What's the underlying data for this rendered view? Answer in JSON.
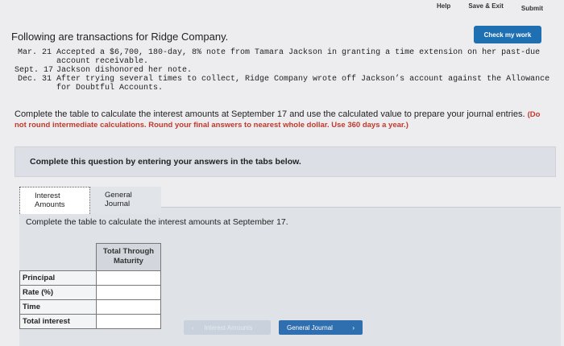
{
  "topbar": {
    "help": "Help",
    "save_exit": "Save & Exit",
    "submit": "Submit"
  },
  "header": {
    "title": "Following are transactions for Ridge Company.",
    "check_button": "Check my work"
  },
  "transactions": [
    {
      "date": "Mar. 21",
      "text": "Accepted a $6,700, 180-day, 8% note from Tamara Jackson in granting a time extension on her past-due account receivable."
    },
    {
      "date": "Sept. 17",
      "text": "Jackson dishonored her note."
    },
    {
      "date": "Dec. 31",
      "text": "After trying several times to collect, Ridge Company wrote off Jackson’s account against the Allowance for Doubtful Accounts."
    }
  ],
  "instruction": {
    "main": "Complete the table to calculate the interest amounts at September 17 and use the calculated value to prepare your journal entries.",
    "emphasis": "(Do not round intermediate calculations. Round your final answers to nearest whole dollar. Use 360 days a year.)"
  },
  "panel": {
    "title": "Complete this question by entering your answers in the tabs below."
  },
  "tabs": [
    {
      "line1": "Interest",
      "line2": "Amounts"
    },
    {
      "line1": "General",
      "line2": "Journal"
    }
  ],
  "content": {
    "title": "Complete the table to calculate the interest amounts at September 17.",
    "column_header_line1": "Total Through",
    "column_header_line2": "Maturity",
    "rows": [
      "Principal",
      "Rate (%)",
      "Time",
      "Total interest"
    ]
  },
  "nav": {
    "prev": "Interest Amounts",
    "next": "General Journal",
    "prev_icon": "chevron-left-icon",
    "next_icon": "chevron-right-icon"
  },
  "colors": {
    "accent": "#1f6fb3",
    "emphasis": "#c0392b"
  }
}
